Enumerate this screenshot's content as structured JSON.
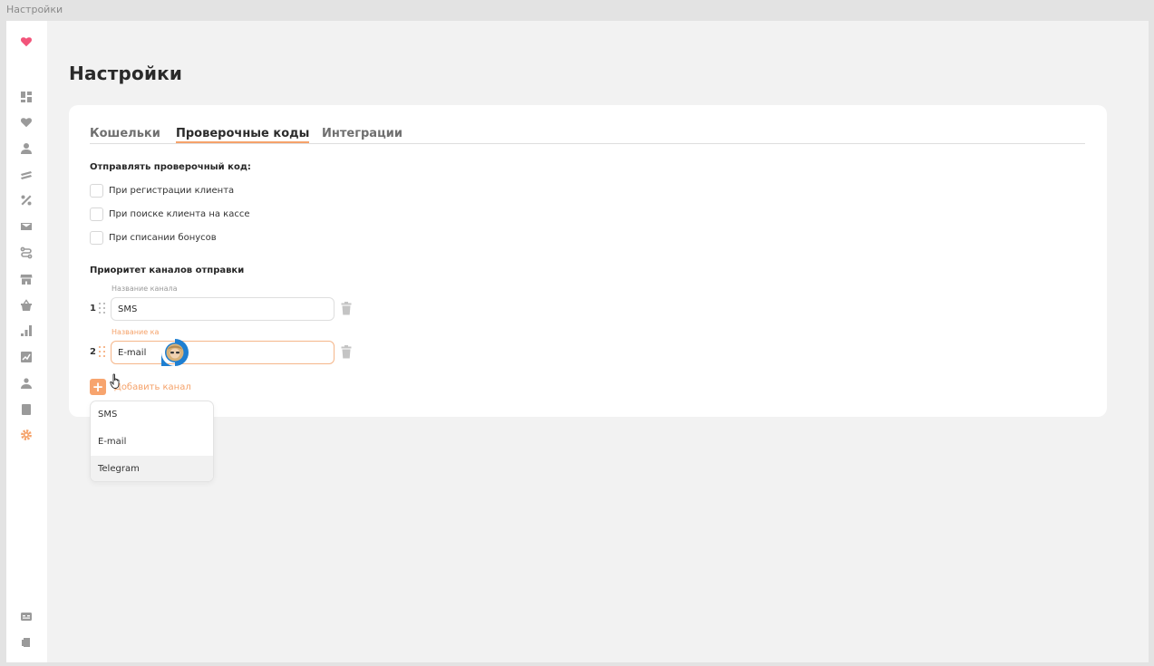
{
  "window": {
    "title": "Настройки"
  },
  "colors": {
    "accent": "#f5a26a",
    "brand_heart": "#f2547a",
    "sidebar_icon": "#9a9a9a"
  },
  "sidebar": {
    "logo": "heart-logo-icon",
    "items": [
      {
        "icon": "dashboard-icon"
      },
      {
        "icon": "heart-icon"
      },
      {
        "icon": "user-icon"
      },
      {
        "icon": "cards-icon"
      },
      {
        "icon": "percent-icon"
      },
      {
        "icon": "mail-icon"
      },
      {
        "icon": "route-icon"
      },
      {
        "icon": "store-icon"
      },
      {
        "icon": "basket-icon"
      },
      {
        "icon": "bar-chart-icon"
      },
      {
        "icon": "analytics-icon"
      },
      {
        "icon": "users-icon"
      },
      {
        "icon": "document-icon"
      },
      {
        "icon": "gear-icon",
        "active": true
      }
    ],
    "bottom_items": [
      {
        "icon": "id-card-icon"
      },
      {
        "icon": "logout-icon"
      }
    ]
  },
  "page": {
    "title": "Настройки"
  },
  "tabs": [
    {
      "label": "Кошельки",
      "active": false
    },
    {
      "label": "Проверочные коды",
      "active": true
    },
    {
      "label": "Интеграции",
      "active": false
    }
  ],
  "send_code": {
    "title": "Отправлять проверочный код:",
    "options": [
      {
        "label": "При регистрации клиента",
        "checked": false
      },
      {
        "label": "При поиске клиента на кассе",
        "checked": false
      },
      {
        "label": "При списании бонусов",
        "checked": false
      }
    ]
  },
  "channels": {
    "title": "Приоритет каналов отправки",
    "field_caption": "Название канала",
    "items": [
      {
        "number": "1",
        "caption": "Название канала",
        "value": "SMS"
      },
      {
        "number": "2",
        "caption": "Название ка",
        "value": "E-mail"
      }
    ],
    "add_label": "Добавить канал",
    "add_icon": "+"
  },
  "dropdown": {
    "options": [
      "SMS",
      "E-mail",
      "Telegram"
    ],
    "hovered": "Telegram"
  }
}
